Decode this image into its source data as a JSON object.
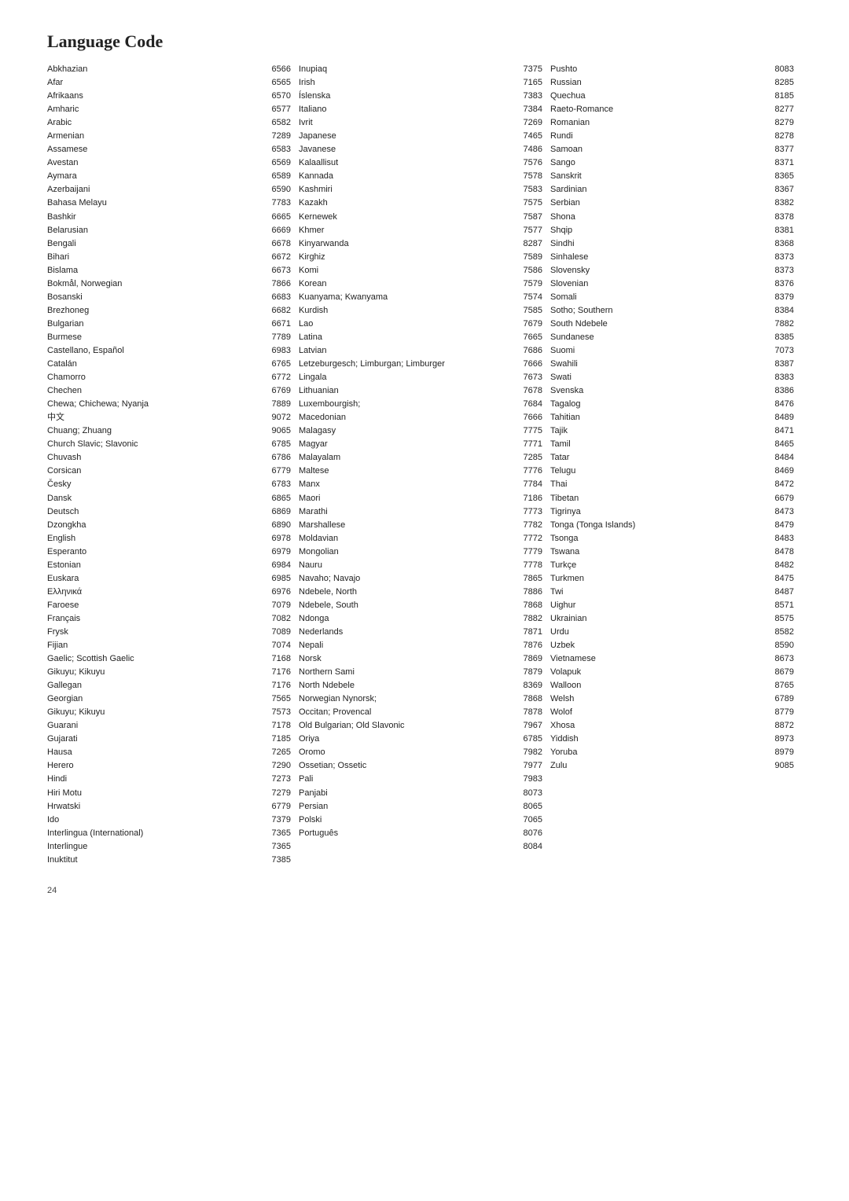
{
  "title": "Language Code",
  "page_number": "24",
  "columns": [
    [
      {
        "name": "Abkhazian",
        "code": "6566"
      },
      {
        "name": "Afar",
        "code": "6565"
      },
      {
        "name": "Afrikaans",
        "code": "6570"
      },
      {
        "name": "Amharic",
        "code": "6577"
      },
      {
        "name": "Arabic",
        "code": "6582"
      },
      {
        "name": "Armenian",
        "code": "7289"
      },
      {
        "name": "Assamese",
        "code": "6583"
      },
      {
        "name": "Avestan",
        "code": "6569"
      },
      {
        "name": "Aymara",
        "code": "6589"
      },
      {
        "name": "Azerbaijani",
        "code": "6590"
      },
      {
        "name": "Bahasa Melayu",
        "code": "7783"
      },
      {
        "name": "Bashkir",
        "code": "6665"
      },
      {
        "name": "Belarusian",
        "code": "6669"
      },
      {
        "name": "Bengali",
        "code": "6678"
      },
      {
        "name": "Bihari",
        "code": "6672"
      },
      {
        "name": "Bislama",
        "code": "6673"
      },
      {
        "name": "Bokmål, Norwegian",
        "code": "7866"
      },
      {
        "name": "Bosanski",
        "code": "6683"
      },
      {
        "name": "Brezhoneg",
        "code": "6682"
      },
      {
        "name": "Bulgarian",
        "code": "6671"
      },
      {
        "name": "Burmese",
        "code": "7789"
      },
      {
        "name": "Castellano, Español",
        "code": "6983"
      },
      {
        "name": "Catalán",
        "code": "6765"
      },
      {
        "name": "Chamorro",
        "code": "6772"
      },
      {
        "name": "Chechen",
        "code": "6769"
      },
      {
        "name": "Chewa; Chichewa; Nyanja",
        "code": "7889"
      },
      {
        "name": "中文",
        "code": "9072"
      },
      {
        "name": "Chuang; Zhuang",
        "code": "9065"
      },
      {
        "name": "Church Slavic; Slavonic",
        "code": "6785"
      },
      {
        "name": "Chuvash",
        "code": "6786"
      },
      {
        "name": "Corsican",
        "code": "6779"
      },
      {
        "name": "Česky",
        "code": "6783"
      },
      {
        "name": "Dansk",
        "code": "6865"
      },
      {
        "name": "Deutsch",
        "code": "6869"
      },
      {
        "name": "Dzongkha",
        "code": "6890"
      },
      {
        "name": "English",
        "code": "6978"
      },
      {
        "name": "Esperanto",
        "code": "6979"
      },
      {
        "name": "Estonian",
        "code": "6984"
      },
      {
        "name": "Euskara",
        "code": "6985"
      },
      {
        "name": "Ελληνικά",
        "code": "6976"
      },
      {
        "name": "Faroese",
        "code": "7079"
      },
      {
        "name": "Français",
        "code": "7082"
      },
      {
        "name": "Frysk",
        "code": "7089"
      },
      {
        "name": "Fijian",
        "code": "7074"
      },
      {
        "name": "Gaelic; Scottish Gaelic",
        "code": "7168"
      },
      {
        "name": "Gikuyu; Kikuyu",
        "code": "7176"
      },
      {
        "name": "Gallegan",
        "code": "7176"
      },
      {
        "name": "Georgian",
        "code": "7565"
      },
      {
        "name": "Gikuyu; Kikuyu",
        "code": "7573"
      },
      {
        "name": "Guarani",
        "code": "7178"
      },
      {
        "name": "Gujarati",
        "code": "7185"
      },
      {
        "name": "Hausa",
        "code": "7265"
      },
      {
        "name": "Herero",
        "code": "7290"
      },
      {
        "name": "Hindi",
        "code": "7273"
      },
      {
        "name": "Hiri Motu",
        "code": "7279"
      },
      {
        "name": "Hrwatski",
        "code": "6779"
      },
      {
        "name": "Ido",
        "code": "7379"
      },
      {
        "name": "Interlingua (International)",
        "code": "7365"
      },
      {
        "name": "Interlingue",
        "code": "7365"
      },
      {
        "name": "Inuktitut",
        "code": "7385"
      }
    ],
    [
      {
        "name": "Inupiaq",
        "code": "7375"
      },
      {
        "name": "Irish",
        "code": "7165"
      },
      {
        "name": "Íslenska",
        "code": "7383"
      },
      {
        "name": "Italiano",
        "code": "7384"
      },
      {
        "name": "Ivrit",
        "code": "7269"
      },
      {
        "name": "Japanese",
        "code": "7465"
      },
      {
        "name": "Javanese",
        "code": "7486"
      },
      {
        "name": "Kalaallisut",
        "code": "7576"
      },
      {
        "name": "Kannada",
        "code": "7578"
      },
      {
        "name": "Kashmiri",
        "code": "7583"
      },
      {
        "name": "Kazakh",
        "code": "7575"
      },
      {
        "name": "Kernewek",
        "code": "7587"
      },
      {
        "name": "Khmer",
        "code": "7577"
      },
      {
        "name": "Kinyarwanda",
        "code": "8287"
      },
      {
        "name": "Kirghiz",
        "code": "7589"
      },
      {
        "name": "Komi",
        "code": "7586"
      },
      {
        "name": "Korean",
        "code": "7579"
      },
      {
        "name": "Kuanyama; Kwanyama",
        "code": "7574"
      },
      {
        "name": "Kurdish",
        "code": "7585"
      },
      {
        "name": "Lao",
        "code": "7679"
      },
      {
        "name": "Latina",
        "code": "7665"
      },
      {
        "name": "Latvian",
        "code": "7686"
      },
      {
        "name": "Letzeburgesch; Limburgan; Limburger",
        "code": "7666"
      },
      {
        "name": "Lingala",
        "code": "7673"
      },
      {
        "name": "Lithuanian",
        "code": "7678"
      },
      {
        "name": "Luxembourgish;",
        "code": "7684"
      },
      {
        "name": "Macedonian",
        "code": "7666"
      },
      {
        "name": "Malagasy",
        "code": "7775"
      },
      {
        "name": "Magyar",
        "code": "7771"
      },
      {
        "name": "Malayalam",
        "code": "7285"
      },
      {
        "name": "Maltese",
        "code": "7776"
      },
      {
        "name": "Manx",
        "code": "7784"
      },
      {
        "name": "Maori",
        "code": "7186"
      },
      {
        "name": "Marathi",
        "code": "7773"
      },
      {
        "name": "Marshallese",
        "code": "7782"
      },
      {
        "name": "Moldavian",
        "code": "7772"
      },
      {
        "name": "Mongolian",
        "code": "7779"
      },
      {
        "name": "Nauru",
        "code": "7778"
      },
      {
        "name": "Navaho; Navajo",
        "code": "7865"
      },
      {
        "name": "Ndebele, North",
        "code": "7886"
      },
      {
        "name": "Ndebele, South",
        "code": "7868"
      },
      {
        "name": "Ndonga",
        "code": "7882"
      },
      {
        "name": "Nederlands",
        "code": "7871"
      },
      {
        "name": "Nepali",
        "code": "7876"
      },
      {
        "name": "Norsk",
        "code": "7869"
      },
      {
        "name": "Northern Sami",
        "code": "7879"
      },
      {
        "name": "North Ndebele",
        "code": "8369"
      },
      {
        "name": "Norwegian Nynorsk;",
        "code": "7868"
      },
      {
        "name": "Occitan; Provencal",
        "code": "7878"
      },
      {
        "name": "Old Bulgarian; Old Slavonic",
        "code": "7967"
      },
      {
        "name": "Oriya",
        "code": "6785"
      },
      {
        "name": "Oromo",
        "code": "7982"
      },
      {
        "name": "Ossetian; Ossetic",
        "code": "7977"
      },
      {
        "name": "Pali",
        "code": "7983"
      },
      {
        "name": "Panjabi",
        "code": "8073"
      },
      {
        "name": "Persian",
        "code": "8065"
      },
      {
        "name": "Polski",
        "code": "7065"
      },
      {
        "name": "Português",
        "code": "8076"
      },
      {
        "name": "",
        "code": "8084"
      }
    ],
    [
      {
        "name": "Pushto",
        "code": "8083"
      },
      {
        "name": "Russian",
        "code": "8285"
      },
      {
        "name": "Quechua",
        "code": "8185"
      },
      {
        "name": "Raeto-Romance",
        "code": "8277"
      },
      {
        "name": "Romanian",
        "code": "8279"
      },
      {
        "name": "Rundi",
        "code": "8278"
      },
      {
        "name": "Samoan",
        "code": "8377"
      },
      {
        "name": "Sango",
        "code": "8371"
      },
      {
        "name": "Sanskrit",
        "code": "8365"
      },
      {
        "name": "Sardinian",
        "code": "8367"
      },
      {
        "name": "Serbian",
        "code": "8382"
      },
      {
        "name": "Shona",
        "code": "8378"
      },
      {
        "name": "Shqip",
        "code": "8381"
      },
      {
        "name": "Sindhi",
        "code": "8368"
      },
      {
        "name": "Sinhalese",
        "code": "8373"
      },
      {
        "name": "Slovensky",
        "code": "8373"
      },
      {
        "name": "Slovenian",
        "code": "8376"
      },
      {
        "name": "Somali",
        "code": "8379"
      },
      {
        "name": "Sotho; Southern",
        "code": "8384"
      },
      {
        "name": "South Ndebele",
        "code": "7882"
      },
      {
        "name": "Sundanese",
        "code": "8385"
      },
      {
        "name": "Suomi",
        "code": "7073"
      },
      {
        "name": "Swahili",
        "code": "8387"
      },
      {
        "name": "Swati",
        "code": "8383"
      },
      {
        "name": "Svenska",
        "code": "8386"
      },
      {
        "name": "Tagalog",
        "code": "8476"
      },
      {
        "name": "Tahitian",
        "code": "8489"
      },
      {
        "name": "Tajik",
        "code": "8471"
      },
      {
        "name": "Tamil",
        "code": "8465"
      },
      {
        "name": "Tatar",
        "code": "8484"
      },
      {
        "name": "Telugu",
        "code": "8469"
      },
      {
        "name": "Thai",
        "code": "8472"
      },
      {
        "name": "Tibetan",
        "code": "6679"
      },
      {
        "name": "Tigrinya",
        "code": "8473"
      },
      {
        "name": "Tonga (Tonga Islands)",
        "code": "8479"
      },
      {
        "name": "Tsonga",
        "code": "8483"
      },
      {
        "name": "Tswana",
        "code": "8478"
      },
      {
        "name": "Turkçe",
        "code": "8482"
      },
      {
        "name": "Turkmen",
        "code": "8475"
      },
      {
        "name": "Twi",
        "code": "8487"
      },
      {
        "name": "Uighur",
        "code": "8571"
      },
      {
        "name": "Ukrainian",
        "code": "8575"
      },
      {
        "name": "Urdu",
        "code": "8582"
      },
      {
        "name": "Uzbek",
        "code": "8590"
      },
      {
        "name": "Vietnamese",
        "code": "8673"
      },
      {
        "name": "Volapuk",
        "code": "8679"
      },
      {
        "name": "Walloon",
        "code": "8765"
      },
      {
        "name": "Welsh",
        "code": "6789"
      },
      {
        "name": "Wolof",
        "code": "8779"
      },
      {
        "name": "Xhosa",
        "code": "8872"
      },
      {
        "name": "Yiddish",
        "code": "8973"
      },
      {
        "name": "Yoruba",
        "code": "8979"
      },
      {
        "name": "Zulu",
        "code": "9085"
      }
    ]
  ]
}
